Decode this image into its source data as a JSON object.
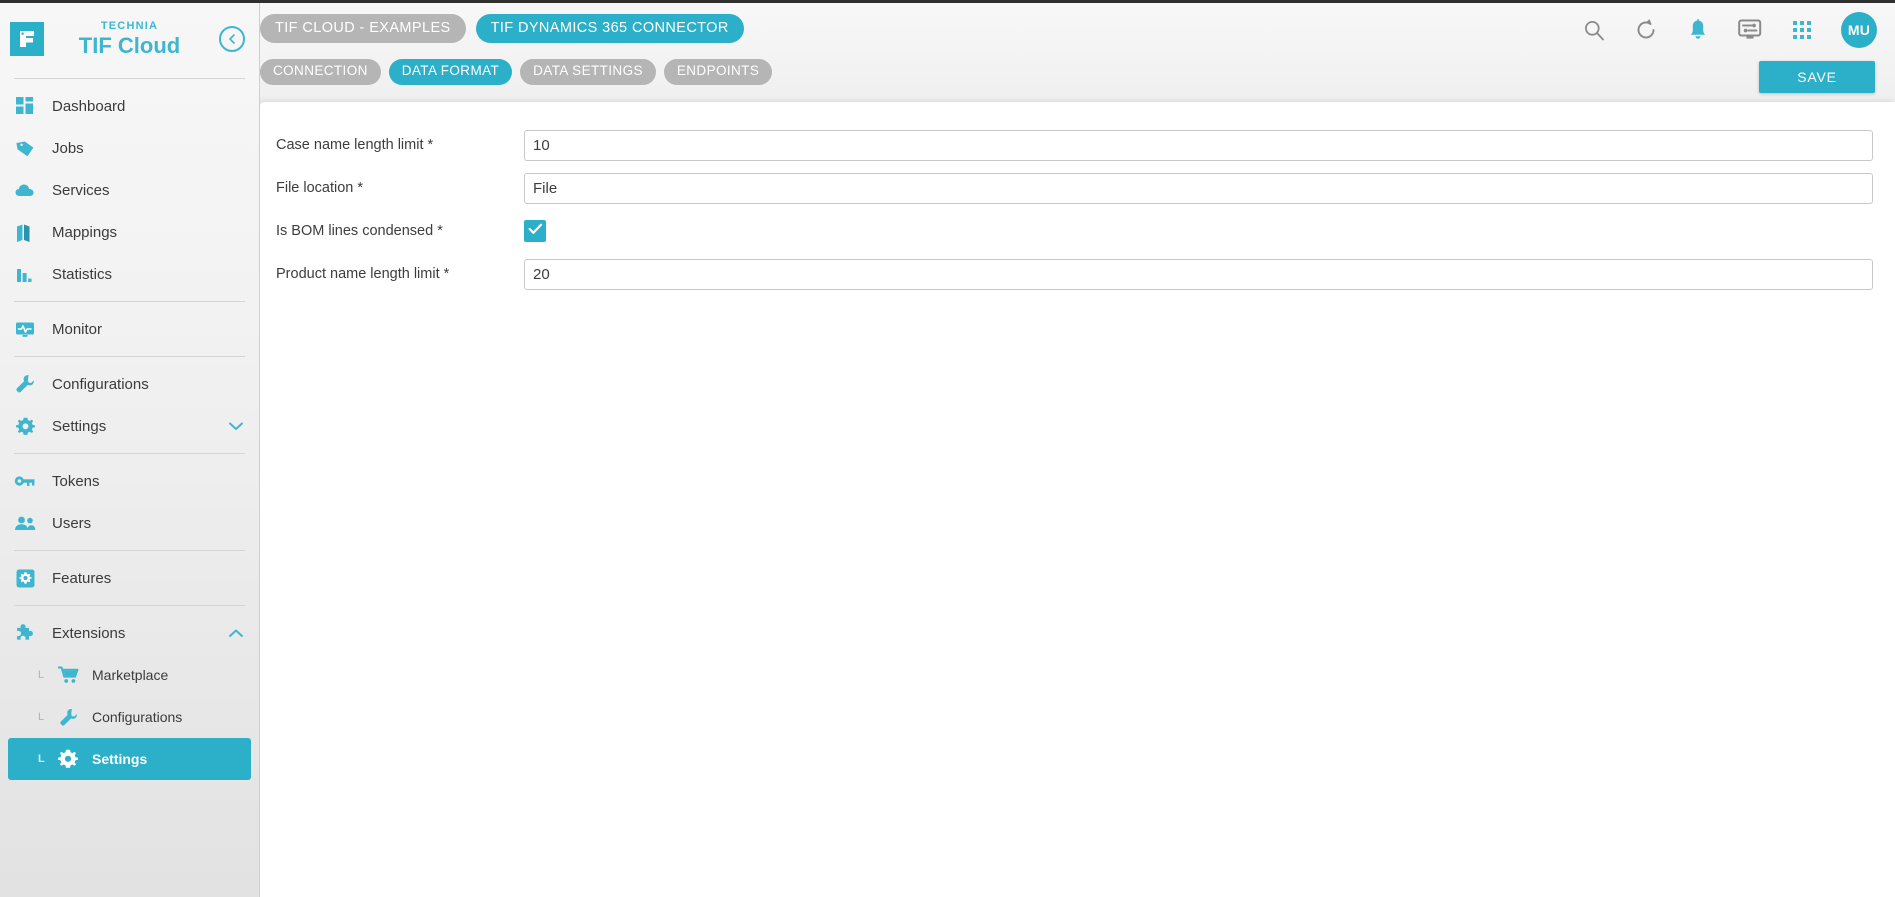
{
  "brand": {
    "logo_icon": "technia-f-logo-icon",
    "top_label": "TECHNIA",
    "main_label": "TIF Cloud",
    "collapse_icon": "collapse-left-arrow-icon"
  },
  "sidebar": {
    "groups": [
      {
        "items": [
          {
            "label": "Dashboard",
            "icon": "dashboard-grid-icon"
          },
          {
            "label": "Jobs",
            "icon": "tag-icon"
          },
          {
            "label": "Services",
            "icon": "cloud-icon"
          },
          {
            "label": "Mappings",
            "icon": "map-icon"
          },
          {
            "label": "Statistics",
            "icon": "bar-chart-icon"
          }
        ]
      },
      {
        "items": [
          {
            "label": "Monitor",
            "icon": "monitor-pulse-icon"
          }
        ]
      },
      {
        "items": [
          {
            "label": "Configurations",
            "icon": "wrench-icon"
          },
          {
            "label": "Settings",
            "icon": "gear-icon",
            "chevron": "chevron-down-icon"
          }
        ]
      },
      {
        "items": [
          {
            "label": "Tokens",
            "icon": "key-icon"
          },
          {
            "label": "Users",
            "icon": "users-icon"
          }
        ]
      },
      {
        "items": [
          {
            "label": "Features",
            "icon": "feature-gear-square-icon"
          }
        ]
      },
      {
        "items": [
          {
            "label": "Extensions",
            "icon": "puzzle-piece-icon",
            "chevron": "chevron-up-icon"
          }
        ],
        "subitems": [
          {
            "label": "Marketplace",
            "icon": "shopping-cart-icon",
            "active": false
          },
          {
            "label": "Configurations",
            "icon": "wrench-icon",
            "active": false
          },
          {
            "label": "Settings",
            "icon": "gear-icon",
            "active": true
          }
        ]
      }
    ]
  },
  "header": {
    "breadcrumb_chips": [
      {
        "label": "TIF CLOUD - EXAMPLES",
        "active": false
      },
      {
        "label": "TIF DYNAMICS 365 CONNECTOR",
        "active": true
      }
    ],
    "tabs": [
      {
        "label": "CONNECTION",
        "active": false
      },
      {
        "label": "DATA FORMAT",
        "active": true
      },
      {
        "label": "DATA SETTINGS",
        "active": false
      },
      {
        "label": "ENDPOINTS",
        "active": false
      }
    ],
    "icons": [
      {
        "name": "search-icon"
      },
      {
        "name": "refresh-icon"
      },
      {
        "name": "bell-icon"
      },
      {
        "name": "display-settings-icon"
      },
      {
        "name": "apps-grid-icon"
      }
    ],
    "avatar_initials": "MU",
    "save_label": "SAVE"
  },
  "form": {
    "fields": [
      {
        "label": "Case name length limit *",
        "type": "text",
        "value": "10",
        "placeholder": ""
      },
      {
        "label": "File location *",
        "type": "text",
        "value": "File",
        "placeholder": ""
      },
      {
        "label": "Is BOM lines condensed *",
        "type": "checkbox",
        "checked": true,
        "check_icon": "check-icon"
      },
      {
        "label": "Product name length limit *",
        "type": "text",
        "value": "20",
        "placeholder": ""
      }
    ]
  },
  "colors": {
    "accent": "#2cafc9",
    "accent_text": "#3fb6cf",
    "chip_inactive": "#b5b5b5",
    "sidebar_bg": "#f2f2f2",
    "text": "#3d3d3d"
  }
}
